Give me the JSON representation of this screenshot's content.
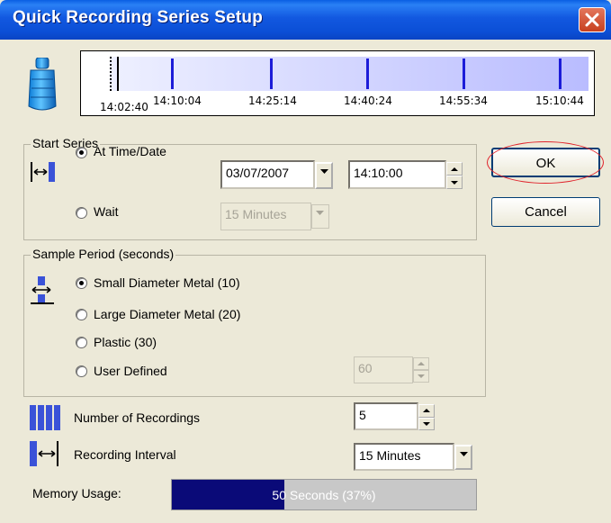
{
  "window": {
    "title": "Quick Recording Series Setup"
  },
  "timeline": {
    "start_label": "14:02:40",
    "tick_labels": [
      "14:10:04",
      "14:25:14",
      "14:40:24",
      "14:55:34",
      "15:10:44"
    ]
  },
  "start_series": {
    "title": "Start Series",
    "at_time_label": "At Time/Date",
    "date_value": "03/07/2007",
    "time_value": "14:10:00",
    "wait_label": "Wait",
    "wait_value": "15 Minutes",
    "selected": "at_time"
  },
  "sample_period": {
    "title": "Sample Period (seconds)",
    "options": [
      {
        "label": "Small Diameter Metal  (10)",
        "checked": true
      },
      {
        "label": "Large Diameter Metal  (20)",
        "checked": false
      },
      {
        "label": "Plastic  (30)",
        "checked": false
      },
      {
        "label": "User Defined",
        "checked": false
      }
    ],
    "user_defined_value": "60"
  },
  "recordings": {
    "label": "Number of Recordings",
    "value": "5"
  },
  "interval": {
    "label": "Recording Interval",
    "value": "15 Minutes"
  },
  "memory": {
    "label": "Memory Usage:",
    "text": "50 Seconds (37%)",
    "fraction": 0.37
  },
  "buttons": {
    "ok": "OK",
    "cancel": "Cancel"
  },
  "colors": {
    "title_bar": "#0b4fd6",
    "timeline_tick": "#1c1cd8",
    "memory_fill": "#0a0a78",
    "highlight": "#e0242c"
  }
}
